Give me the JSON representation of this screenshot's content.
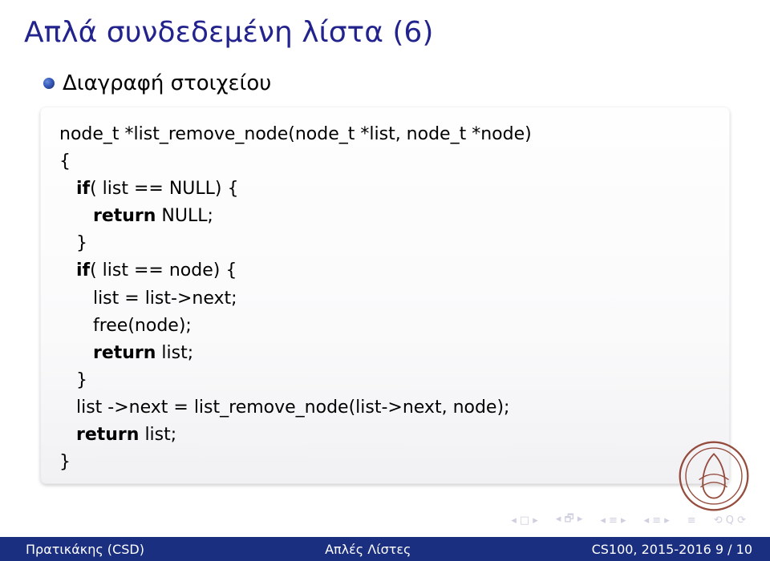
{
  "title": "Απλά συνδεδεμένη λίστα (6)",
  "bullet": "Διαγραφή στοιχείου",
  "code": {
    "l1": "node_t *list_remove_node(node_t *list, node_t *node)",
    "l2": "{",
    "l3a": "   ",
    "kw_if1": "if",
    "l3b": "( list == NULL) {",
    "l4a": "      ",
    "kw_ret1": "return",
    "l4b": " NULL;",
    "l5": "   }",
    "l6a": "   ",
    "kw_if2": "if",
    "l6b": "( list == node) {",
    "l7": "      list = list->next;",
    "l8": "      free(node);",
    "l9a": "      ",
    "kw_ret2": "return",
    "l9b": " list;",
    "l10": "   }",
    "l11": "   list ->next = list_remove_node(list->next, node);",
    "l12a": "   ",
    "kw_ret3": "return",
    "l12b": " list;",
    "l13": "}"
  },
  "footer": {
    "left": "Πρατικάκης (CSD)",
    "center": "Απλές Λίστες",
    "right": "CS100, 2015-2016     9 / 10"
  }
}
